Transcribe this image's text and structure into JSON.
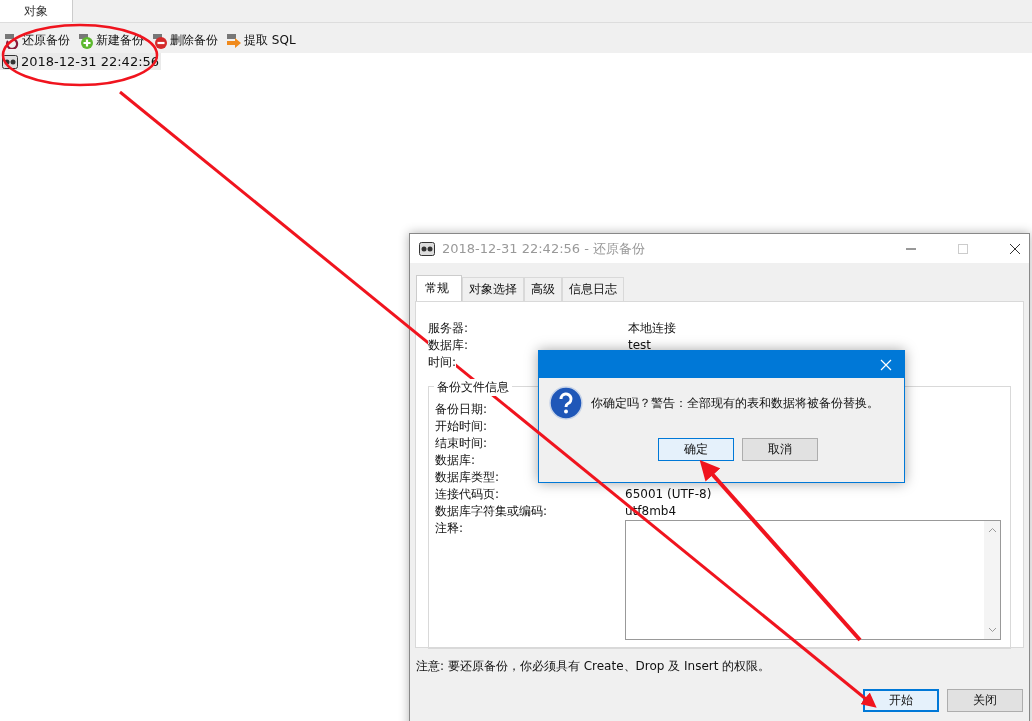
{
  "top_tabs": [
    {
      "label": "对象",
      "selected": true
    }
  ],
  "toolbar": [
    {
      "kind": "restore",
      "label": "还原备份"
    },
    {
      "kind": "new",
      "label": "新建备份"
    },
    {
      "kind": "delete",
      "label": "删除备份"
    },
    {
      "kind": "extract",
      "label": "提取 SQL"
    }
  ],
  "backups": [
    {
      "label": "2018-12-31 22:42:56",
      "selected": true
    }
  ],
  "dialog": {
    "title": "2018-12-31 22:42:56 - 还原备份",
    "tabs": [
      {
        "label": "常规",
        "selected": true
      },
      {
        "label": "对象选择",
        "selected": false
      },
      {
        "label": "高级",
        "selected": false
      },
      {
        "label": "信息日志",
        "selected": false
      }
    ],
    "info": [
      {
        "label": "服务器:",
        "value": "本地连接"
      },
      {
        "label": "数据库:",
        "value": "test"
      },
      {
        "label": "时间:"
      }
    ],
    "group_title": "备份文件信息",
    "file_info": [
      {
        "label": "备份日期:"
      },
      {
        "label": "开始时间:"
      },
      {
        "label": "结束时间:"
      },
      {
        "label": "数据库:"
      },
      {
        "label": "数据库类型:"
      },
      {
        "label": "连接代码页:",
        "value": "65001 (UTF-8)"
      },
      {
        "label": "数据库字符集或编码:",
        "value": "utf8mb4"
      }
    ],
    "comment_label": "注释:",
    "note": "注意: 要还原备份，你必须具有 Create、Drop 及 Insert 的权限。",
    "buttons": [
      {
        "label": "开始",
        "default": true
      },
      {
        "label": "关闭",
        "default": false
      }
    ]
  },
  "message": {
    "text": "你确定吗？警告：全部现有的表和数据将被备份替换。",
    "buttons": [
      {
        "label": "确定",
        "default": true
      },
      {
        "label": "取消",
        "default": false
      }
    ]
  }
}
